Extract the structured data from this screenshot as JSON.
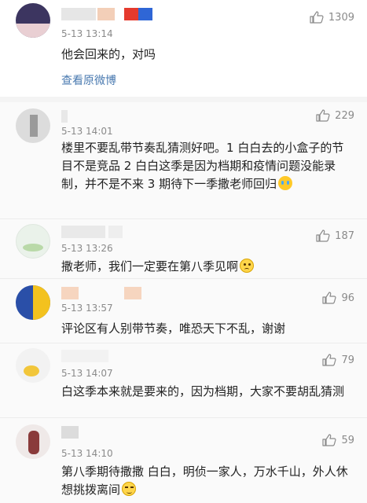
{
  "colors": {
    "link": "#4a7ab0",
    "meta": "#8a8a8a",
    "text": "#222222"
  },
  "top_comment": {
    "name": "",
    "time": "5-13 13:14",
    "text": "他会回来的，对吗",
    "likes": "1309",
    "view_original": "查看原微博"
  },
  "comments": [
    {
      "name": "",
      "time": "5-13 14:01",
      "text": "楼里不要乱带节奏乱猜测好吧。1 白白去的小盒子的节目不是竞品 2 白白这季是因为档期和疫情问题没能录制，并不是不来 3 期待下一季撒老师回归",
      "likes": "229",
      "emoji": "crying-face"
    },
    {
      "name": "",
      "time": "5-13 13:26",
      "text": "撒老师，我们一定要在第八季见啊",
      "likes": "187",
      "emoji": "sad-face"
    },
    {
      "name": "",
      "time": "5-13 13:57",
      "text": "评论区有人别带节奏，唯恐天下不乱，谢谢",
      "likes": "96"
    },
    {
      "name": "",
      "time": "5-13 14:07",
      "text": "白这季本来就是要来的，因为档期，大家不要胡乱猜测",
      "likes": "79"
    },
    {
      "name": "",
      "time": "5-13 14:10",
      "text": "第八季期待撒撒 白白，明侦一家人，万水千山，外人休想挑拨离间",
      "likes": "59",
      "emoji": "smirk-face"
    }
  ]
}
